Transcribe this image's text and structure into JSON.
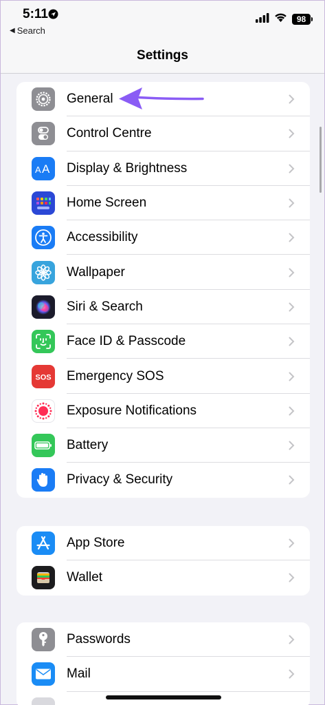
{
  "status_bar": {
    "time": "5:11",
    "back_label": "Search",
    "battery_level": "98"
  },
  "nav": {
    "title": "Settings"
  },
  "groups": [
    {
      "items": [
        {
          "label": "General",
          "icon": "gear-icon",
          "color": "#8e8e93"
        },
        {
          "label": "Control Centre",
          "icon": "toggles-icon",
          "color": "#8e8e93"
        },
        {
          "label": "Display & Brightness",
          "icon": "text-size-icon",
          "color": "#1a7cf5"
        },
        {
          "label": "Home Screen",
          "icon": "app-grid-icon",
          "color": "#2b48d6"
        },
        {
          "label": "Accessibility",
          "icon": "accessibility-icon",
          "color": "#1a7cf5"
        },
        {
          "label": "Wallpaper",
          "icon": "flower-icon",
          "color": "#38a4dd"
        },
        {
          "label": "Siri & Search",
          "icon": "siri-icon",
          "color": "#1b1b2b"
        },
        {
          "label": "Face ID & Passcode",
          "icon": "face-id-icon",
          "color": "#34c759"
        },
        {
          "label": "Emergency SOS",
          "icon": "sos-icon",
          "color": "#e53935"
        },
        {
          "label": "Exposure Notifications",
          "icon": "exposure-icon",
          "color": "#ffffff"
        },
        {
          "label": "Battery",
          "icon": "battery-icon",
          "color": "#34c759"
        },
        {
          "label": "Privacy & Security",
          "icon": "hand-icon",
          "color": "#1a7cf5"
        }
      ]
    },
    {
      "items": [
        {
          "label": "App Store",
          "icon": "app-store-icon",
          "color": "#1a8cf5"
        },
        {
          "label": "Wallet",
          "icon": "wallet-icon",
          "color": "#1c1c1e"
        }
      ]
    },
    {
      "items": [
        {
          "label": "Passwords",
          "icon": "key-icon",
          "color": "#8e8e93"
        },
        {
          "label": "Mail",
          "icon": "mail-icon",
          "color": "#1a8cf5"
        }
      ]
    }
  ],
  "annotation": {
    "color": "#8a5cf5"
  }
}
